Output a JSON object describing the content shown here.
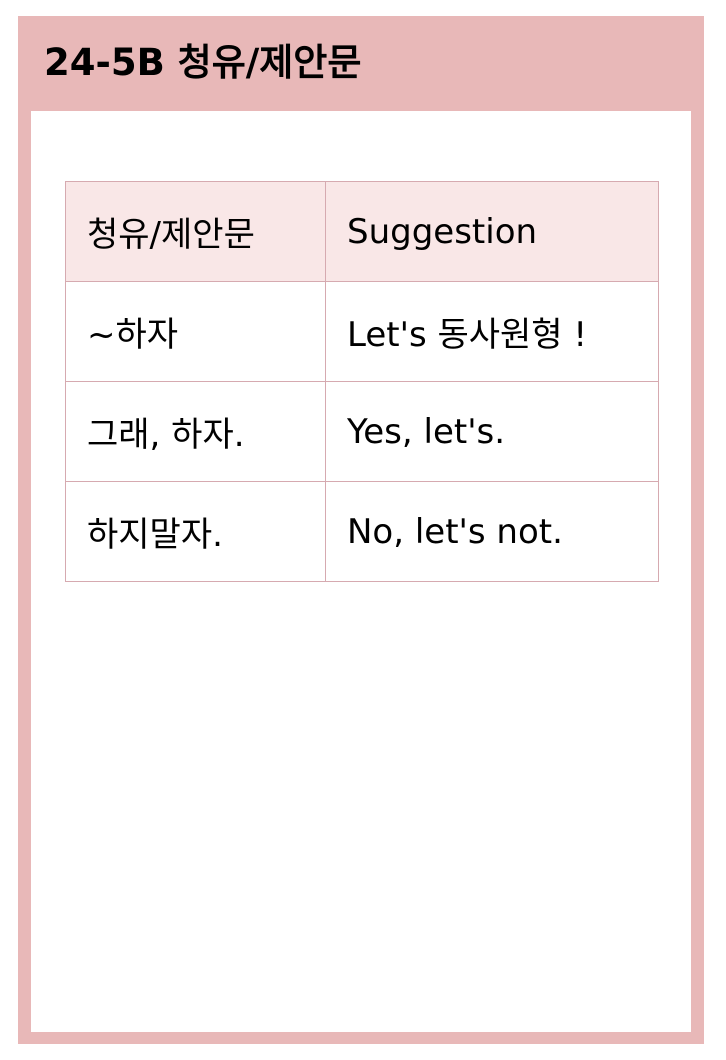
{
  "header": {
    "title": "24-5B 청유/제안문"
  },
  "table": {
    "header": {
      "korean": "청유/제안문",
      "english": "Suggestion"
    },
    "rows": [
      {
        "korean": "~하자",
        "english": "Let's 동사원형 !"
      },
      {
        "korean": "그래, 하자.",
        "english": "Yes, let's."
      },
      {
        "korean": "하지말자.",
        "english": "No, let's not."
      }
    ]
  },
  "colors": {
    "frame": "#e8b8b8",
    "header_cell_bg": "#f9e7e7",
    "table_border": "#d6aab0"
  }
}
